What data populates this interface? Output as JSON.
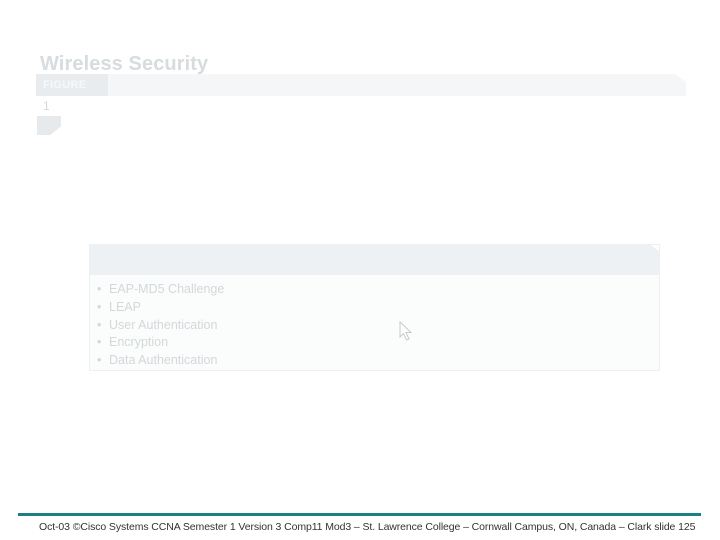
{
  "slide": {
    "title": "Wireless Security",
    "figure_label": "FIGURE",
    "figure_number": "1"
  },
  "panel": {
    "items": [
      "EAP-MD5 Challenge",
      "LEAP",
      "User Authentication",
      "Encryption",
      "Data Authentication"
    ]
  },
  "footer": {
    "text": "Oct-03 ©Cisco Systems CCNA Semester 1 Version 3 Comp11 Mod3 – St. Lawrence College – Cornwall Campus, ON, Canada – Clark slide 125"
  },
  "colors": {
    "accent": "#1c7f86",
    "faded_text": "#d3d8db"
  },
  "icons": {
    "cursor": "mouse-pointer-icon"
  }
}
